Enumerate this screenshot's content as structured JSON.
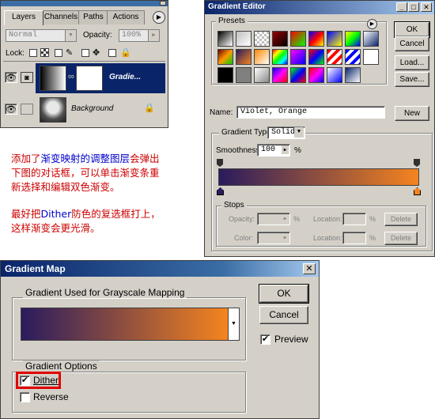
{
  "layers_palette": {
    "tabs": [
      "Layers",
      "Channels",
      "Paths",
      "Actions"
    ],
    "blend_mode": "Normal",
    "opacity_label": "Opacity:",
    "opacity_value": "100%",
    "lock_label": "Lock:",
    "layers": [
      {
        "name": "Gradie...",
        "selected": true
      },
      {
        "name": "Background",
        "selected": false
      }
    ]
  },
  "gradient_editor": {
    "title": "Gradient Editor",
    "presets_label": "Presets",
    "buttons": {
      "ok": "OK",
      "cancel": "Cancel",
      "load": "Load...",
      "save": "Save..."
    },
    "name_label": "Name:",
    "name_value": "Violet, Orange",
    "new_button": "New",
    "gradient_type_label": "Gradient Type:",
    "gradient_type_value": "Solid",
    "smoothness_label": "Smoothness:",
    "smoothness_value": "100",
    "smoothness_unit": "%",
    "stops_label": "Stops",
    "opacity_label": "Opacity:",
    "color_label": "Color:",
    "location_label": "Location:",
    "percent": "%",
    "delete_label": "Delete",
    "gradient_colors": {
      "start": "#2a1b5e",
      "end": "#f5841f"
    }
  },
  "annotation": {
    "line1_pre": "添加了",
    "line1_blue": "渐变映射的调整图层",
    "line1_post": "会弹出",
    "line2": "下图的对话框，可以单击渐变条重",
    "line3": "新选择和编辑双色渐变。",
    "line4_pre": "最好把",
    "line4_blue": "Dither",
    "line4_post": "防色的复选框打上，",
    "line5": "这样渐变会更光滑。"
  },
  "gradient_map": {
    "title": "Gradient Map",
    "group1_label": "Gradient Used for Grayscale Mapping",
    "ok": "OK",
    "cancel": "Cancel",
    "preview_label": "Preview",
    "preview_checked": true,
    "group2_label": "Gradient Options",
    "dither_label": "Dither",
    "dither_checked": true,
    "reverse_label": "Reverse",
    "reverse_checked": false,
    "highlight_color": "#e00000"
  }
}
